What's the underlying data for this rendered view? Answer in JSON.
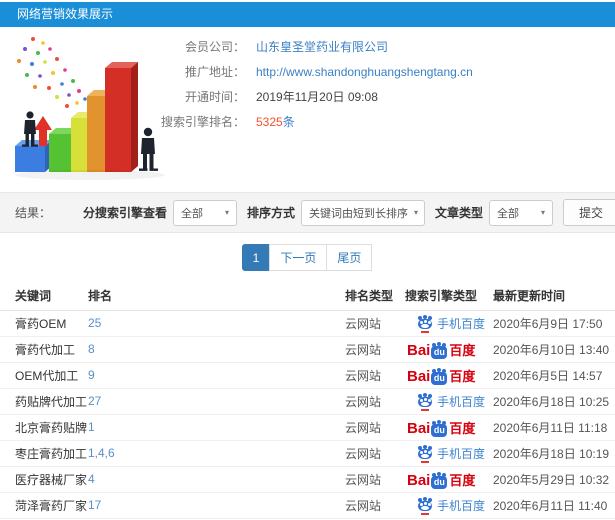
{
  "header": {
    "title": "网络营销效果展示"
  },
  "info": {
    "rows": [
      {
        "label": "会员公司：",
        "value": "山东皇圣堂药业有限公司"
      },
      {
        "label": "推广地址：",
        "value": "http://www.shandonghuangshengtang.cn"
      },
      {
        "label": "开通时间：",
        "value": "2019年11月20日 09:08"
      },
      {
        "label": "搜索引擎排名：",
        "value": "5325",
        "suffix": "条"
      }
    ]
  },
  "filters": {
    "result_label": "结果：",
    "engine_label": "分搜索引擎查看",
    "engine_value": "全部",
    "sort_label": "排序方式",
    "sort_value": "关键词由短到长排序",
    "article_label": "文章类型",
    "article_value": "全部",
    "submit_label": "提交",
    "caret": "▾"
  },
  "pagination": {
    "current": "1",
    "next": "下一页",
    "last": "尾页"
  },
  "table": {
    "headers": [
      "关键词",
      "排名",
      "排名类型",
      "搜索引擎类型",
      "最新更新时间"
    ],
    "rows": [
      {
        "keyword": "膏药OEM",
        "rank": "25",
        "rank_type": "云网站",
        "engine": "mobile-baidu",
        "time": "2020年6月9日 17:50"
      },
      {
        "keyword": "膏药代加工",
        "rank": "8",
        "rank_type": "云网站",
        "engine": "baidu",
        "time": "2020年6月10日 13:40"
      },
      {
        "keyword": "OEM代加工",
        "rank": "9",
        "rank_type": "云网站",
        "engine": "baidu",
        "time": "2020年6月5日 14:57"
      },
      {
        "keyword": "药贴牌代加工",
        "rank": "27",
        "rank_type": "云网站",
        "engine": "mobile-baidu",
        "time": "2020年6月18日 10:25"
      },
      {
        "keyword": "北京膏药贴牌",
        "rank": "1",
        "rank_type": "云网站",
        "engine": "baidu",
        "time": "2020年6月11日 11:18"
      },
      {
        "keyword": "枣庄膏药加工",
        "rank": "1,4,6",
        "rank_type": "云网站",
        "engine": "mobile-baidu",
        "time": "2020年6月18日 10:19"
      },
      {
        "keyword": "医疗器械厂家",
        "rank": "4",
        "rank_type": "云网站",
        "engine": "baidu",
        "time": "2020年5月29日 10:32"
      },
      {
        "keyword": "菏泽膏药厂家",
        "rank": "17",
        "rank_type": "云网站",
        "engine": "mobile-baidu",
        "time": "2020年6月11日 11:40"
      }
    ]
  },
  "engine_logos": {
    "mobile_label": "手机百度",
    "baidu_bai": "Bai",
    "baidu_du": "du",
    "baidu_cn": "百度"
  },
  "colors": {
    "titlebar_blue": "#1b8ed8",
    "link_blue": "#3b7fc4",
    "highlight_orange": "#f4512c",
    "rank_blue": "#5a8fc8",
    "pagination_blue": "#337ab7",
    "baidu_red": "#d7000f",
    "baidu_blue": "#2e6fd2"
  }
}
